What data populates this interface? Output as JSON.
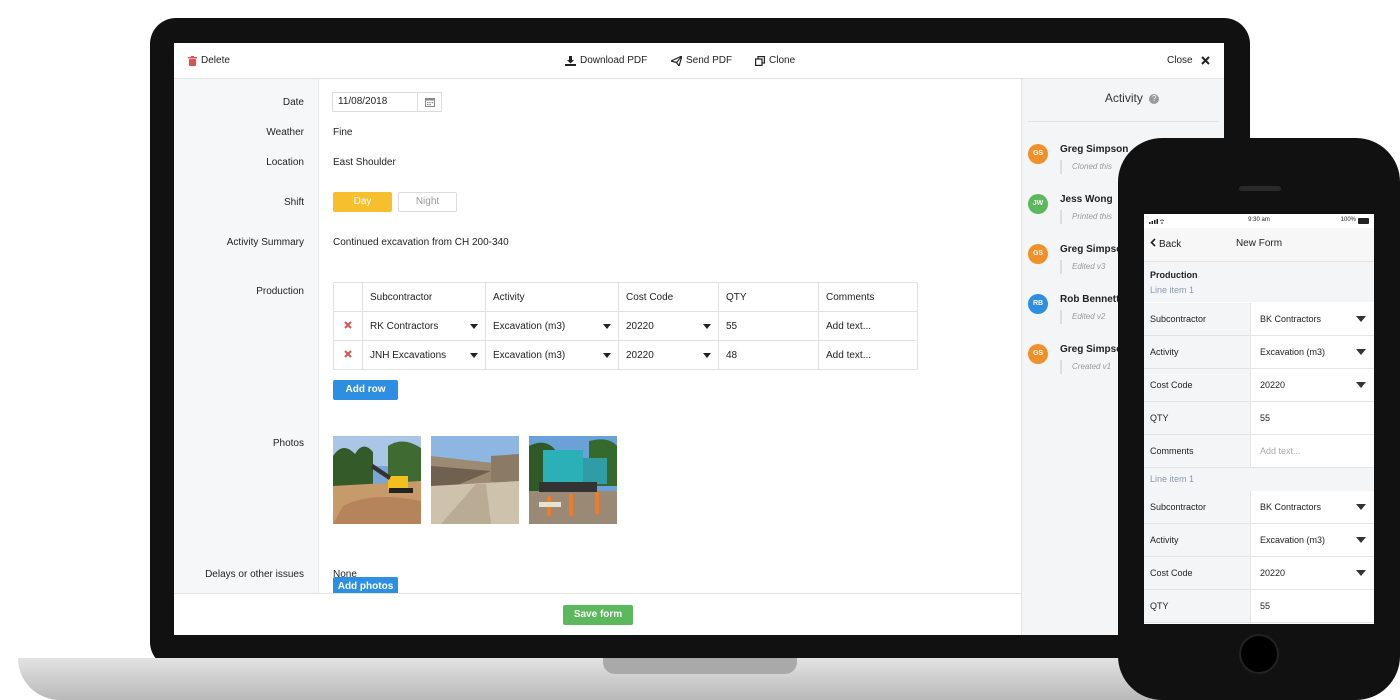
{
  "toolbar": {
    "delete": "Delete",
    "download_pdf": "Download PDF",
    "send_pdf": "Send PDF",
    "clone": "Clone",
    "close": "Close"
  },
  "form": {
    "labels": {
      "date": "Date",
      "weather": "Weather",
      "location": "Location",
      "shift": "Shift",
      "activity_summary": "Activity Summary",
      "production": "Production",
      "photos": "Photos",
      "delays": "Delays or other issues"
    },
    "date": "11/08/2018",
    "weather": "Fine",
    "location": "East Shoulder",
    "shift": {
      "day": "Day",
      "night": "Night",
      "selected": "Day"
    },
    "activity_summary": "Continued excavation from CH 200-340",
    "production": {
      "headers": [
        "Subcontractor",
        "Activity",
        "Cost Code",
        "QTY",
        "Comments"
      ],
      "rows": [
        {
          "subcontractor": "RK Contractors",
          "activity": "Excavation (m3)",
          "cost_code": "20220",
          "qty": "55",
          "comments_placeholder": "Add text..."
        },
        {
          "subcontractor": "JNH Excavations",
          "activity": "Excavation (m3)",
          "cost_code": "20220",
          "qty": "48",
          "comments_placeholder": "Add text..."
        }
      ],
      "add_row": "Add row"
    },
    "add_photos": "Add photos",
    "delays": "None",
    "save": "Save form"
  },
  "activity": {
    "title": "Activity",
    "entries": [
      {
        "initials": "GS",
        "name": "Greg Simpson",
        "note": "Cloned this",
        "color": "#f0902a"
      },
      {
        "initials": "JW",
        "name": "Jess Wong",
        "note": "Printed this",
        "color": "#5cb85c"
      },
      {
        "initials": "GS",
        "name": "Greg Simpson",
        "note": "Edited v3",
        "color": "#f0902a"
      },
      {
        "initials": "RB",
        "name": "Rob Bennett",
        "note": "Edited v2",
        "color": "#2d8ee2"
      },
      {
        "initials": "GS",
        "name": "Greg Simpson",
        "note": "Created v1",
        "color": "#f0902a"
      }
    ]
  },
  "phone": {
    "time": "9:30 am",
    "battery": "100%",
    "back": "Back",
    "title": "New Form",
    "section": "Production",
    "line_item_1": "Line item 1",
    "line_item_2": "Line item 1",
    "rows1": [
      {
        "label": "Subcontractor",
        "value": "BK Contractors"
      },
      {
        "label": "Activity",
        "value": "Excavation (m3)"
      },
      {
        "label": "Cost Code",
        "value": "20220"
      },
      {
        "label": "QTY",
        "value": "55"
      },
      {
        "label": "Comments",
        "value": "Add text..."
      }
    ],
    "rows2": [
      {
        "label": "Subcontractor",
        "value": "BK Contractors"
      },
      {
        "label": "Activity",
        "value": "Excavation (m3)"
      },
      {
        "label": "Cost Code",
        "value": "20220"
      },
      {
        "label": "QTY",
        "value": "55"
      }
    ]
  }
}
